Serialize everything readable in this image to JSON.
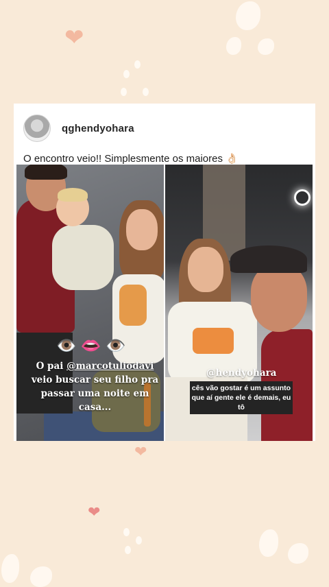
{
  "post": {
    "username": "qghendyohara",
    "caption": "O encontro veio!! Simplesmente os maiores",
    "caption_emoji": "👌🏻"
  },
  "left_story": {
    "emojis": "👁️👄👁️",
    "text_before": "O pai ",
    "mention": "@marcotuliodavi",
    "text_after": " veio buscar seu filho pra passar uma noite em casa..."
  },
  "right_story": {
    "mention": "@hendyohara",
    "caption": "cês vão gostar é um assunto que aí gente ele é demais, eu tô"
  },
  "colors": {
    "background": "#f9ead8",
    "card": "#ffffff",
    "jersey": "#7f1d25"
  }
}
